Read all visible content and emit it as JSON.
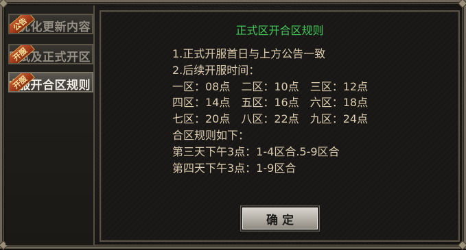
{
  "sidebar": {
    "tabs": [
      {
        "badge": "公告",
        "label": "优化更新内容",
        "active": false
      },
      {
        "badge": "开服",
        "label": "测试及正式开区",
        "active": false
      },
      {
        "badge": "开服",
        "label": "正式服开合区规则",
        "active": true
      }
    ]
  },
  "panel": {
    "title": "正式区开合区规则",
    "lines": [
      "1.正式开服首日与上方公告一致",
      "2.后续开服时间：",
      "一区：08点　二区：10点　三区：12点",
      "四区：14点　五区：16点　六区：18点",
      "七区：20点　八区：22点　九区：24点",
      "合区规则如下：",
      "第三天下午3点：1-4区合.5-9区合",
      "第四天下午3点：1-9区合"
    ],
    "confirm_label": "确定"
  },
  "colors": {
    "title": "#43c95a",
    "body_text": "#dccdb0",
    "badge": "#a83a18"
  }
}
